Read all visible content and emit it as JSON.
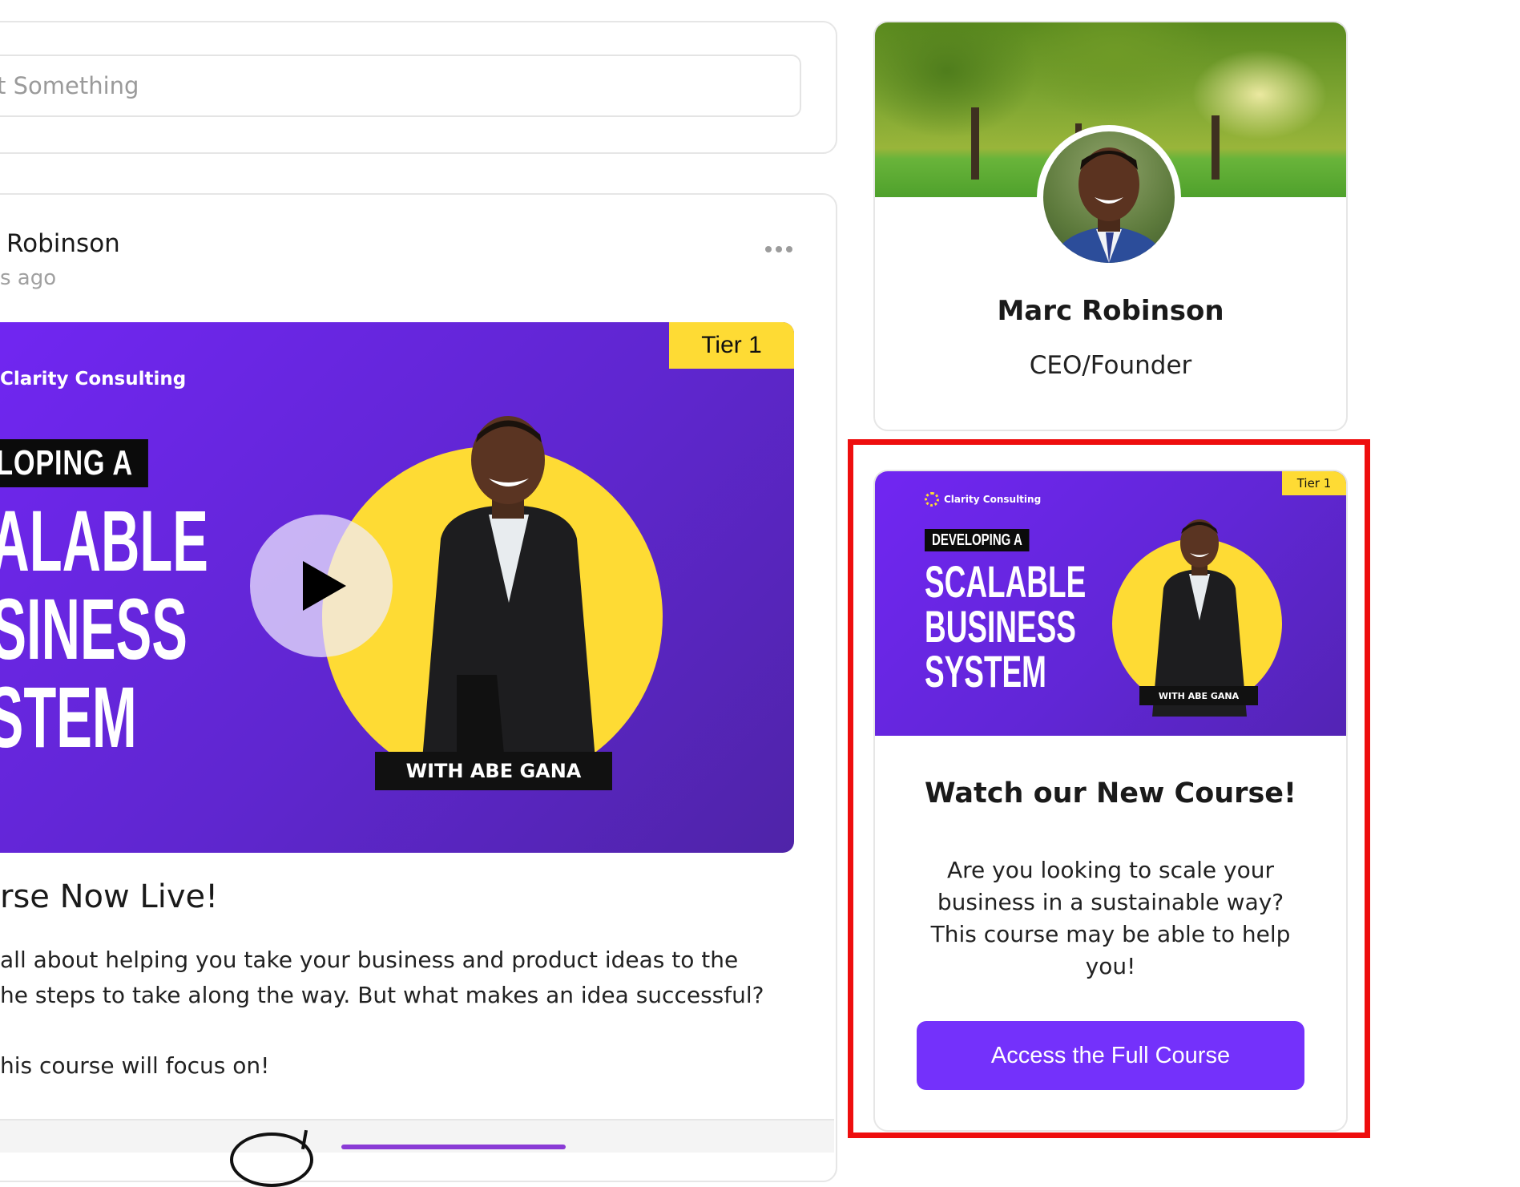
{
  "composer": {
    "placeholder": "t Something"
  },
  "post": {
    "author": "Robinson",
    "time": "s ago",
    "banner": {
      "tier": "Tier 1",
      "brand": "Clarity Consulting",
      "subtitle": "VELOPING A",
      "title_lines": [
        "CALABLE",
        "USINESS",
        "YSTEM"
      ],
      "with": "WITH ABE GANA"
    },
    "title": "rse Now Live!",
    "body_lines": [
      " all about helping you take your business and product ideas to the",
      "he steps to take along the way. But what makes an idea successful?",
      "",
      "his course will focus on!"
    ]
  },
  "profile": {
    "name": "Marc Robinson",
    "role": "CEO/Founder"
  },
  "course": {
    "thumb": {
      "tier": "Tier 1",
      "brand": "Clarity Consulting",
      "subtitle": "DEVELOPING A",
      "title_lines": [
        "SCALABLE",
        "BUSINESS",
        "SYSTEM"
      ],
      "with": "WITH ABE GANA"
    },
    "title": "Watch our New Course!",
    "description": "Are you looking to scale your business in a sustainable way? This course may be able to help you!",
    "button_label": "Access the Full Course"
  },
  "colors": {
    "accent": "#7431fb",
    "banner_purple": "#6126d6",
    "badge_yellow": "#fedb34",
    "highlight_red": "#ee0e0e"
  }
}
